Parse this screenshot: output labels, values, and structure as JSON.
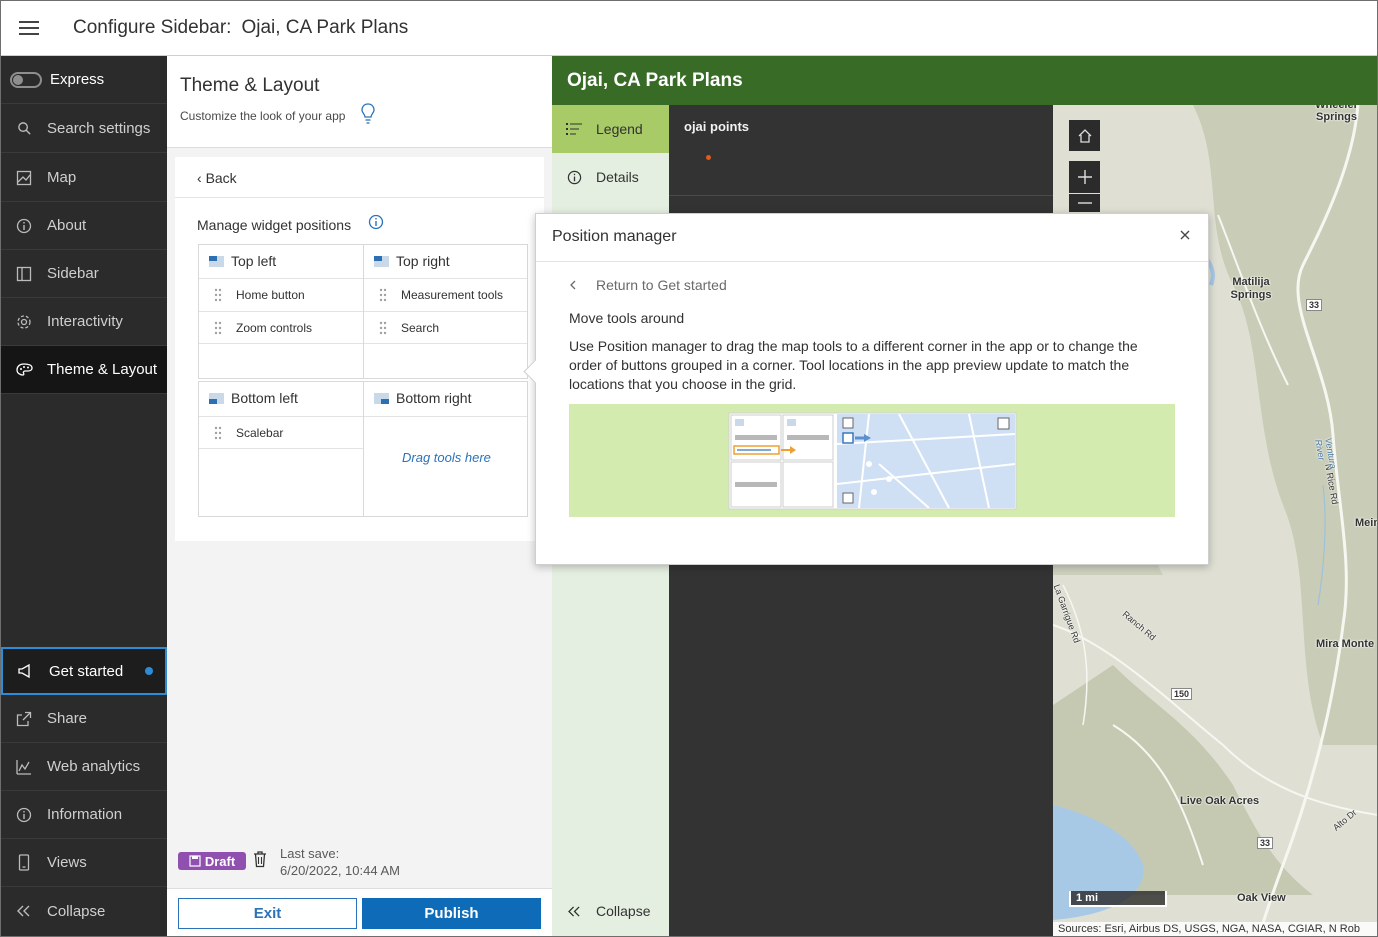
{
  "topbar": {
    "title": "Configure Sidebar:",
    "app_name": "Ojai, CA Park Plans"
  },
  "nav": {
    "express": "Express",
    "items": [
      {
        "label": "Search settings",
        "icon": "search-icon"
      },
      {
        "label": "Map",
        "icon": "map-icon"
      },
      {
        "label": "About",
        "icon": "info-icon"
      },
      {
        "label": "Sidebar",
        "icon": "sidebar-icon"
      },
      {
        "label": "Interactivity",
        "icon": "gear-icon"
      },
      {
        "label": "Theme & Layout",
        "icon": "palette-icon"
      }
    ],
    "bottom": [
      {
        "label": "Get started",
        "icon": "megaphone-icon"
      },
      {
        "label": "Share",
        "icon": "share-icon"
      },
      {
        "label": "Web analytics",
        "icon": "analytics-icon"
      },
      {
        "label": "Information",
        "icon": "info-icon"
      },
      {
        "label": "Views",
        "icon": "device-icon"
      },
      {
        "label": "Collapse",
        "icon": "chevrons-left-icon"
      }
    ]
  },
  "panel": {
    "title": "Theme & Layout",
    "subtitle": "Customize the look of your app",
    "back": "Back",
    "manage": "Manage widget positions",
    "top_left": {
      "header": "Top left",
      "items": [
        "Home button",
        "Zoom controls"
      ]
    },
    "top_right": {
      "header": "Top right",
      "items": [
        "Measurement tools",
        "Search"
      ]
    },
    "bottom_left": {
      "header": "Bottom left",
      "items": [
        "Scalebar"
      ]
    },
    "bottom_right": {
      "header": "Bottom right",
      "placeholder": "Drag tools here"
    },
    "draft": "Draft",
    "last_save_label": "Last save:",
    "last_save_value": "6/20/2022, 10:44 AM",
    "exit": "Exit",
    "publish": "Publish"
  },
  "preview": {
    "app_title": "Ojai, CA Park Plans",
    "rail": {
      "legend": "Legend",
      "details": "Details",
      "collapse": "Collapse"
    },
    "legend_layer": "ojai points",
    "map_labels": [
      "Wheeler Springs",
      "Matilija Springs",
      "Mira Monte",
      "Live Oak Acres",
      "Oak View",
      "Mein",
      "33",
      "150",
      "33",
      "N Rice Rd",
      "Ventura River",
      "Ranch Rd",
      "La Garrigue Rd",
      "Alto Dr"
    ],
    "scalebar": "1 mi",
    "attribution": "Sources: Esri, Airbus DS, USGS, NGA, NASA, CGIAR, N Rob"
  },
  "modal": {
    "title": "Position manager",
    "return": "Return to Get started",
    "heading": "Move tools around",
    "description": "Use Position manager to drag the map tools to a different corner in the app or to change the order of buttons grouped in a corner. Tool locations in the app preview update to match the locations that you choose in the grid."
  },
  "colors": {
    "header_green": "#386b25",
    "nav_dark": "#2b2b2b",
    "primary_blue": "#0d6bb8",
    "selected_green": "#a8cb68",
    "draft_purple": "#8f50b0",
    "illustration_bg": "#d3ebaf"
  }
}
